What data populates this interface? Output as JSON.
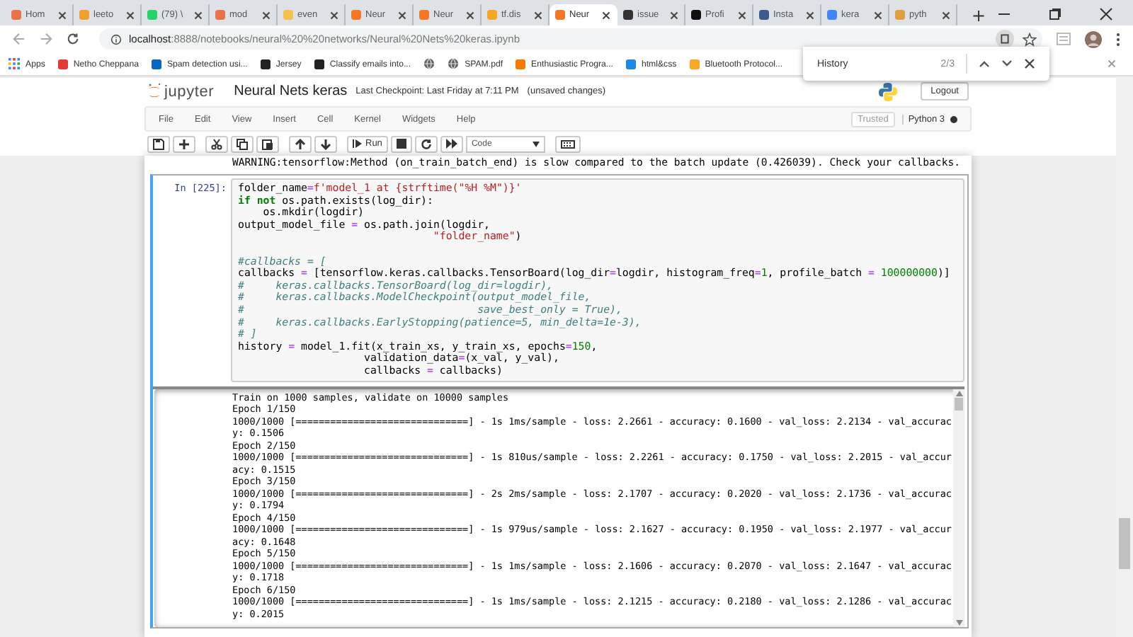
{
  "browser": {
    "tabs": [
      {
        "label": "Hom",
        "color": "#e8734a",
        "selected": false
      },
      {
        "label": "leeto",
        "color": "#f0a030",
        "selected": false
      },
      {
        "label": "(79) \\",
        "color": "#25d366",
        "selected": false
      },
      {
        "label": "mod",
        "color": "#e8734a",
        "selected": false
      },
      {
        "label": "even",
        "color": "#f2c14e",
        "selected": false
      },
      {
        "label": "Neur",
        "color": "#f37726",
        "selected": false
      },
      {
        "label": "Neur",
        "color": "#f37726",
        "selected": false
      },
      {
        "label": "tf.dis",
        "color": "#f5a623",
        "selected": false
      },
      {
        "label": "Neur",
        "color": "#f37726",
        "selected": true
      },
      {
        "label": "issue",
        "color": "#333333",
        "selected": false
      },
      {
        "label": "Profi",
        "color": "#111111",
        "selected": false
      },
      {
        "label": "Insta",
        "color": "#3b5b8c",
        "selected": false
      },
      {
        "label": "kera",
        "color": "#4285f4",
        "selected": false
      },
      {
        "label": "pyth",
        "color": "#e0a040",
        "selected": false
      }
    ],
    "new_tab": "+",
    "address": {
      "host": "localhost",
      "path": ":8888/notebooks/neural%20%20networks/Neural%20Nets%20keras.ipynb"
    },
    "bookmarks": [
      {
        "kind": "apps",
        "label": "Apps"
      },
      {
        "kind": "favicon",
        "label": "Netho Cheppana",
        "color": "#e53935"
      },
      {
        "kind": "favicon",
        "label": "Spam detection usi...",
        "color": "#0a66c2"
      },
      {
        "kind": "favicon",
        "label": "Jersey",
        "color": "#222222"
      },
      {
        "kind": "favicon",
        "label": "Classify emails into...",
        "color": "#222222"
      },
      {
        "kind": "globe"
      },
      {
        "kind": "globe",
        "label": "SPAM.pdf"
      },
      {
        "kind": "favicon",
        "label": "Enthusiastic Progra...",
        "color": "#f57c00"
      },
      {
        "kind": "favicon",
        "label": "html&css",
        "color": "#1e88e5"
      },
      {
        "kind": "favicon",
        "label": "Bluetooth Protocol...",
        "color": "#f9a825"
      }
    ],
    "find_bar": {
      "query": "History",
      "count": "2/3"
    }
  },
  "notebook": {
    "logo": "jupyter",
    "title": "Neural Nets keras",
    "checkpoint": "Last Checkpoint: Last Friday at 7:11 PM",
    "status": "(unsaved changes)",
    "logout": "Logout",
    "menu": [
      "File",
      "Edit",
      "View",
      "Insert",
      "Cell",
      "Kernel",
      "Widgets",
      "Help"
    ],
    "trusted": "Trusted",
    "kernel": "Python 3",
    "kernel_busy": true,
    "run": "Run",
    "cell_type": "Code"
  },
  "warning": "WARNING:tensorflow:Method (on_train_batch_end) is slow compared to the batch update (0.426039). Check your callbacks.",
  "cell": {
    "prompt": "In [225]:",
    "selected": true,
    "code_blocks": [
      [
        [
          {
            "kind": "plain",
            "text": "folder_name"
          },
          {
            "kind": "op",
            "text": "="
          },
          {
            "kind": "str",
            "text": "f'model_1 at {strftime(\"%H %M\")}'"
          }
        ],
        [
          {
            "kind": "kw",
            "text": "if not"
          },
          {
            "kind": "plain",
            "text": " os.path.exists(log_dir):"
          }
        ],
        [
          {
            "kind": "plain",
            "text": "    os.mkdir(logdir)"
          }
        ],
        [
          {
            "kind": "plain",
            "text": "output_model_file "
          },
          {
            "kind": "op",
            "text": "="
          },
          {
            "kind": "plain",
            "text": " os.path.join(logdir,"
          }
        ],
        [
          {
            "kind": "str",
            "text": "                               \"folder_name\""
          },
          {
            "kind": "plain",
            "text": ")"
          }
        ]
      ],
      [
        [
          {
            "kind": "comment",
            "text": "#callbacks = ["
          }
        ],
        [
          {
            "kind": "plain",
            "text": "callbacks "
          },
          {
            "kind": "op",
            "text": "="
          },
          {
            "kind": "plain",
            "text": " [tensorflow.keras.callbacks.TensorBoard(log_dir"
          },
          {
            "kind": "op",
            "text": "="
          },
          {
            "kind": "plain",
            "text": "logdir, histogram_freq"
          },
          {
            "kind": "op",
            "text": "="
          },
          {
            "kind": "num",
            "text": "1"
          },
          {
            "kind": "plain",
            "text": ", profile_batch "
          },
          {
            "kind": "op",
            "text": "= "
          },
          {
            "kind": "num",
            "text": "100000000"
          },
          {
            "kind": "plain",
            "text": ")]"
          }
        ],
        [
          {
            "kind": "comment",
            "text": "#     keras.callbacks.TensorBoard(log_dir=logdir),"
          }
        ],
        [
          {
            "kind": "comment",
            "text": "#     keras.callbacks.ModelCheckpoint(output_model_file,"
          }
        ],
        [
          {
            "kind": "comment",
            "text": "#                                     save_best_only = True),"
          }
        ],
        [
          {
            "kind": "comment",
            "text": "#     keras.callbacks.EarlyStopping(patience=5, min_delta=1e-3),"
          }
        ],
        [
          {
            "kind": "comment",
            "text": "# ]"
          }
        ],
        [
          {
            "kind": "plain",
            "text": "history "
          },
          {
            "kind": "op",
            "text": "="
          },
          {
            "kind": "plain",
            "text": " model_1.fit(x_train_xs, y_train_xs, epochs"
          },
          {
            "kind": "op",
            "text": "="
          },
          {
            "kind": "num",
            "text": "150"
          },
          {
            "kind": "plain",
            "text": ","
          }
        ],
        [
          {
            "kind": "plain",
            "text": "                    validation_data"
          },
          {
            "kind": "op",
            "text": "="
          },
          {
            "kind": "plain",
            "text": "(x_val, y_val),"
          }
        ],
        [
          {
            "kind": "plain",
            "text": "                    callbacks "
          },
          {
            "kind": "op",
            "text": "="
          },
          {
            "kind": "plain",
            "text": " callbacks)"
          }
        ]
      ]
    ],
    "output": [
      "Train on 1000 samples, validate on 10000 samples",
      "Epoch 1/150",
      "1000/1000 [==============================] - 1s 1ms/sample - loss: 2.2661 - accuracy: 0.1600 - val_loss: 2.2134 - val_accurac",
      "y: 0.1506",
      "Epoch 2/150",
      "1000/1000 [==============================] - 1s 810us/sample - loss: 2.2261 - accuracy: 0.1750 - val_loss: 2.2015 - val_accur",
      "acy: 0.1515",
      "Epoch 3/150",
      "1000/1000 [==============================] - 2s 2ms/sample - loss: 2.1707 - accuracy: 0.2020 - val_loss: 2.1736 - val_accurac",
      "y: 0.1794",
      "Epoch 4/150",
      "1000/1000 [==============================] - 1s 979us/sample - loss: 2.1627 - accuracy: 0.1950 - val_loss: 2.1977 - val_accur",
      "acy: 0.1648",
      "Epoch 5/150",
      "1000/1000 [==============================] - 1s 1ms/sample - loss: 2.1606 - accuracy: 0.2070 - val_loss: 2.1647 - val_accurac",
      "y: 0.1718",
      "Epoch 6/150",
      "1000/1000 [==============================] - 1s 1ms/sample - loss: 2.1215 - accuracy: 0.2180 - val_loss: 2.1286 - val_accurac",
      "y: 0.2015"
    ]
  }
}
